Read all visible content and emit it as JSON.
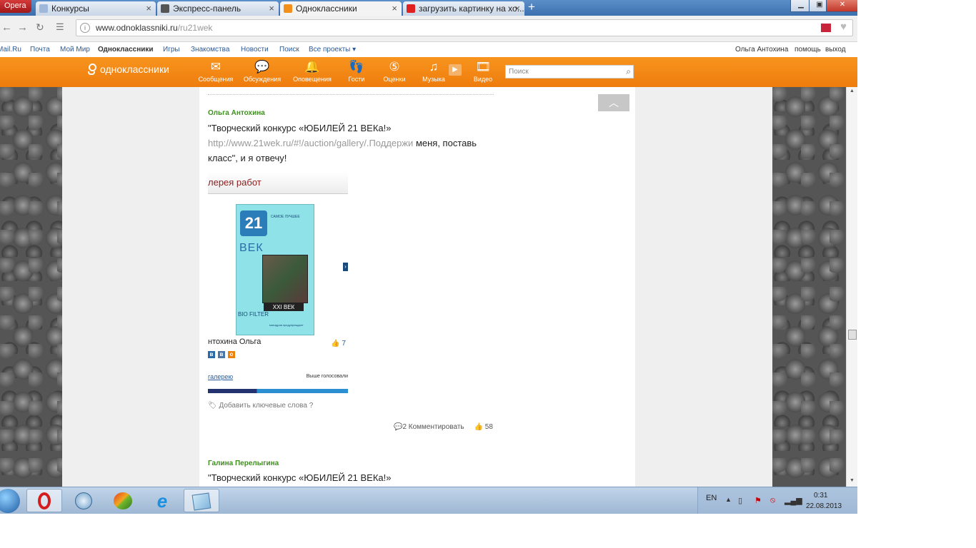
{
  "browser": {
    "menu_label": "Opera",
    "tabs": [
      {
        "label": "Конкурсы",
        "icon": "page-icon"
      },
      {
        "label": "Экспресс-панель",
        "icon": "grid-icon"
      },
      {
        "label": "Одноклассники",
        "icon": "odnoklassniki-icon"
      },
      {
        "label": "загрузить картинку на хо...",
        "icon": "yandex-icon"
      }
    ],
    "new_tab_label": "+",
    "url_main": "www.odnoklassniki.ru",
    "url_path": "/ru21wek"
  },
  "portal_bar": {
    "left_links": [
      "Mail.Ru",
      "Почта",
      "Мой Мир",
      "Одноклассники",
      "Игры",
      "Знакомства",
      "Новости",
      "Поиск",
      "Все проекты"
    ],
    "user_name": "Ольга Антохина",
    "help": "помощь",
    "logout": "выход"
  },
  "ok_header": {
    "logo": "одноклассники",
    "nav": [
      {
        "label": "Сообщения",
        "icon": "envelope-icon"
      },
      {
        "label": "Обсуждения",
        "icon": "speech-bubbles-icon"
      },
      {
        "label": "Оповещения",
        "icon": "bell-icon"
      },
      {
        "label": "Гости",
        "icon": "footprints-icon"
      },
      {
        "label": "Оценки",
        "icon": "rating-five-icon"
      },
      {
        "label": "Музыка",
        "icon": "music-note-icon"
      },
      {
        "label": "Видео",
        "icon": "film-icon"
      }
    ],
    "search_placeholder": "Поиск"
  },
  "feed": {
    "post1": {
      "author": "Ольга Антохина",
      "text_start": "\"Творческий конкурс «ЮБИЛЕЙ 21 ВЕКа!»",
      "link": "http://www.21wek.ru/#!/auction/gallery/.Поддержи",
      "text_end": " меня, поставь класс\", и я отвечу!",
      "gallery_title": "лерея работ",
      "card_small": "САМОЕ ЛУЧШЕЕ",
      "card_vek": "ВЕК",
      "card_xxi": "XXI ВЕК",
      "card_bio": "BIO FILTER",
      "card_tag": "минздрав предупреждает",
      "card_name": "нтохина Ольга",
      "card_likes": "7",
      "gallery_link": "галерею",
      "gallery_right": "Выше голосовали",
      "keywords": "Добавить ключевые слова",
      "comments": "2 Комментировать",
      "likes": "58"
    },
    "post2": {
      "author": "Галина Перелыгина",
      "text": "\"Творческий конкурс «ЮБИЛЕЙ 21 ВЕКа!»"
    }
  },
  "taskbar": {
    "lang": "EN",
    "time": "0:31",
    "date": "22.08.2013"
  }
}
